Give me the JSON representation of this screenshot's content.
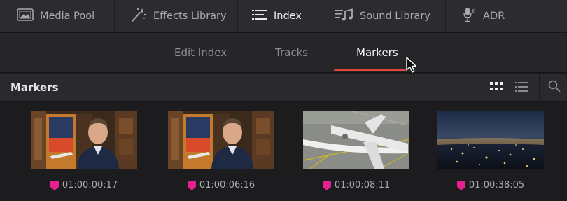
{
  "toolbar": {
    "items": [
      {
        "label": "Media Pool",
        "icon": "media-pool-icon"
      },
      {
        "label": "Effects Library",
        "icon": "effects-wand-icon"
      },
      {
        "label": "Index",
        "icon": "index-list-icon",
        "active": true
      },
      {
        "label": "Sound Library",
        "icon": "sound-library-icon"
      },
      {
        "label": "ADR",
        "icon": "microphone-icon"
      }
    ]
  },
  "tabs": {
    "items": [
      {
        "label": "Edit Index"
      },
      {
        "label": "Tracks"
      },
      {
        "label": "Markers",
        "active": true
      }
    ]
  },
  "section": {
    "title": "Markers",
    "view_modes": [
      "grid-view-icon",
      "list-view-icon"
    ],
    "search_icon": "search-icon"
  },
  "markers": [
    {
      "timecode": "01:00:00:17",
      "color": "#e6208f",
      "thumbnail": "presenter-in-office"
    },
    {
      "timecode": "01:00:06:16",
      "color": "#e6208f",
      "thumbnail": "presenter-in-office"
    },
    {
      "timecode": "01:00:08:11",
      "color": "#e6208f",
      "thumbnail": "airplane-on-runway"
    },
    {
      "timecode": "01:00:38:05",
      "color": "#e6208f",
      "thumbnail": "city-lights-aerial-night"
    }
  ],
  "colors": {
    "accent_underline": "#e0473c",
    "marker": "#e6208f",
    "background": "#1c1c1f"
  }
}
